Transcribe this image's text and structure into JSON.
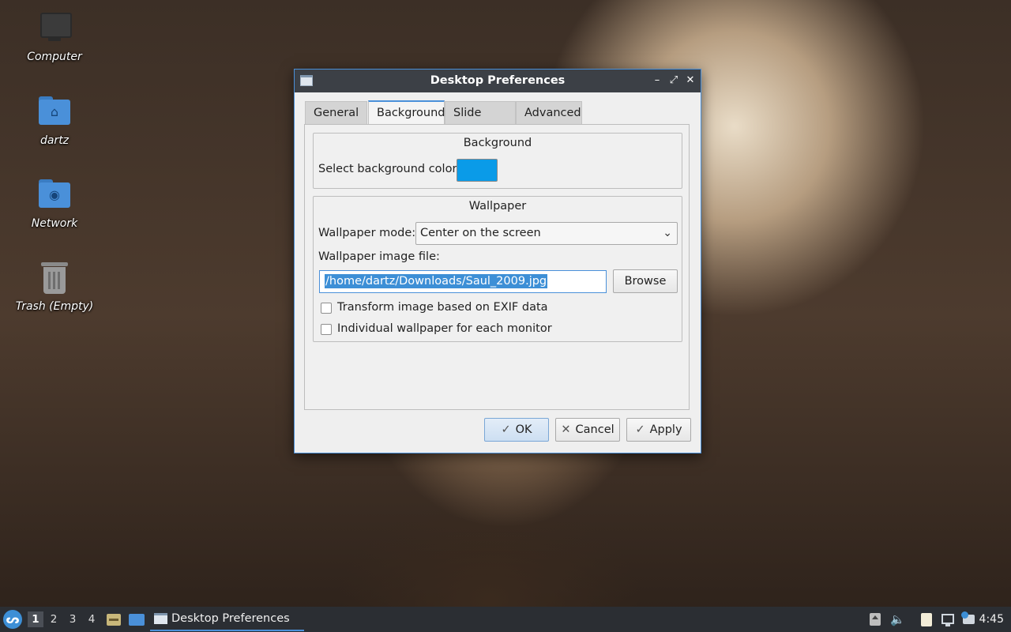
{
  "desktop": {
    "icons": [
      {
        "label": "Computer"
      },
      {
        "label": "dartz"
      },
      {
        "label": "Network"
      },
      {
        "label": "Trash (Empty)"
      }
    ]
  },
  "dialog": {
    "title": "Desktop Preferences",
    "tabs": [
      "General",
      "Background",
      "Slide Show",
      "Advanced"
    ],
    "active_tab": "Background",
    "background_group": {
      "title": "Background",
      "color_label": "Select background color:",
      "color_value": "#0a9be8"
    },
    "wallpaper_group": {
      "title": "Wallpaper",
      "mode_label": "Wallpaper mode:",
      "mode_value": "Center on the screen",
      "file_label": "Wallpaper image file:",
      "file_value": "/home/dartz/Downloads/Saul_2009.jpg",
      "browse_label": "Browse",
      "exif_label": "Transform image based on EXIF data",
      "exif_checked": false,
      "per_monitor_label": "Individual wallpaper for each monitor",
      "per_monitor_checked": false
    },
    "buttons": {
      "ok": "OK",
      "cancel": "Cancel",
      "apply": "Apply"
    }
  },
  "taskbar": {
    "workspaces": [
      "1",
      "2",
      "3",
      "4"
    ],
    "active_workspace": "1",
    "task_label": "Desktop Preferences",
    "clock": "4:45"
  },
  "colors": {
    "accent": "#4a90d9",
    "selection": "#3d8fd6",
    "titlebar": "#3c4046",
    "taskbar": "#2b2e33"
  }
}
